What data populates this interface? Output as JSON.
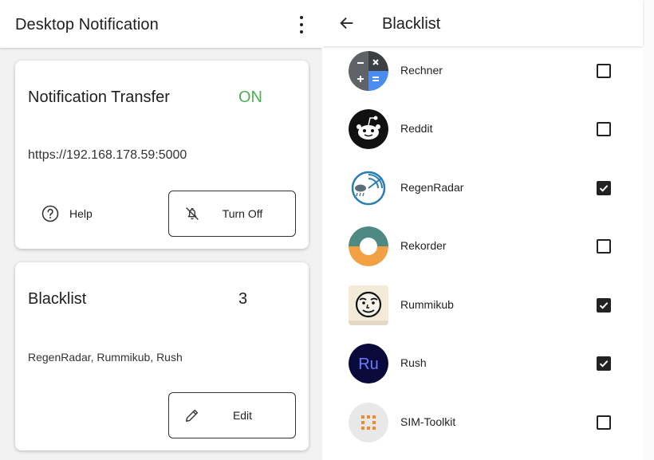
{
  "left_screen": {
    "appbar": {
      "title": "Desktop Notification"
    },
    "transfer_card": {
      "title": "Notification Transfer",
      "status": "ON",
      "status_color": "#4caf50",
      "server_url": "https://192.168.178.59:5000",
      "help_label": "Help",
      "help_icon": "help-circle-icon",
      "turn_off_label": "Turn Off",
      "turn_off_icon": "bell-off-icon"
    },
    "blacklist_card": {
      "title": "Blacklist",
      "count": "3",
      "names": "RegenRadar, Rummikub, Rush",
      "edit_label": "Edit",
      "edit_icon": "pencil-icon"
    }
  },
  "right_screen": {
    "appbar": {
      "title": "Blacklist",
      "back_icon": "arrow-left-icon"
    },
    "apps": [
      {
        "name": "Rechner",
        "checked": false,
        "icon": "calculator-icon"
      },
      {
        "name": "Reddit",
        "checked": false,
        "icon": "reddit-icon"
      },
      {
        "name": "RegenRadar",
        "checked": true,
        "icon": "regenradar-icon"
      },
      {
        "name": "Rekorder",
        "checked": false,
        "icon": "recorder-icon"
      },
      {
        "name": "Rummikub",
        "checked": true,
        "icon": "rummikub-icon"
      },
      {
        "name": "Rush",
        "checked": true,
        "icon": "rush-icon",
        "icon_text": "Ru"
      },
      {
        "name": "SIM-Toolkit",
        "checked": false,
        "icon": "sim-toolkit-icon"
      }
    ]
  }
}
